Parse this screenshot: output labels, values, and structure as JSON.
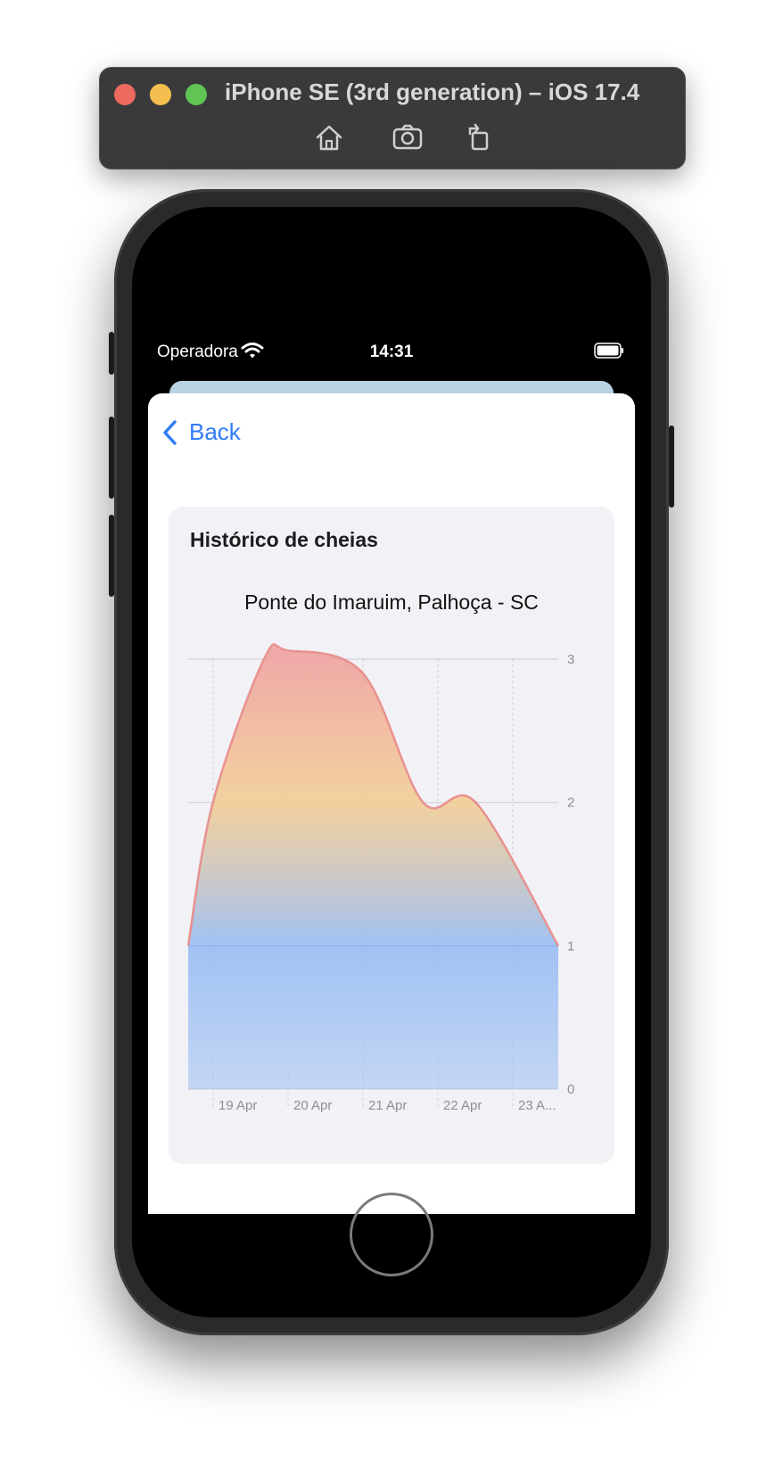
{
  "simulator": {
    "title": "iPhone SE (3rd generation) – iOS 17.4",
    "tools": [
      "home-icon",
      "screenshot-icon",
      "rotate-icon"
    ]
  },
  "status_bar": {
    "carrier": "Operadora",
    "time": "14:31"
  },
  "nav": {
    "back_label": "Back"
  },
  "card": {
    "title": "Histórico de cheias"
  },
  "colors": {
    "accent": "#2f7cf6",
    "line": "#e79290",
    "fill_top": "#ef9e9a",
    "fill_mid": "#f3c989",
    "fill_bottom": "#9dbff3"
  },
  "chart_data": {
    "type": "area",
    "title": "Ponte do Imaruim, Palhoça - SC",
    "categories": [
      "19 Apr",
      "20 Apr",
      "21 Apr",
      "22 Apr",
      "23 A..."
    ],
    "x": [
      -0.33,
      0,
      0.68,
      1,
      2,
      2.8,
      3.5,
      4.6
    ],
    "values": [
      1,
      2,
      3,
      3.06,
      2.9,
      2,
      2,
      1
    ],
    "threshold": 1,
    "ylim": [
      0,
      3
    ],
    "yticks": [
      0,
      1,
      2,
      3
    ],
    "y_axis_position": "right",
    "xlabel": "",
    "ylabel": "",
    "grid": true,
    "legend": "none"
  }
}
